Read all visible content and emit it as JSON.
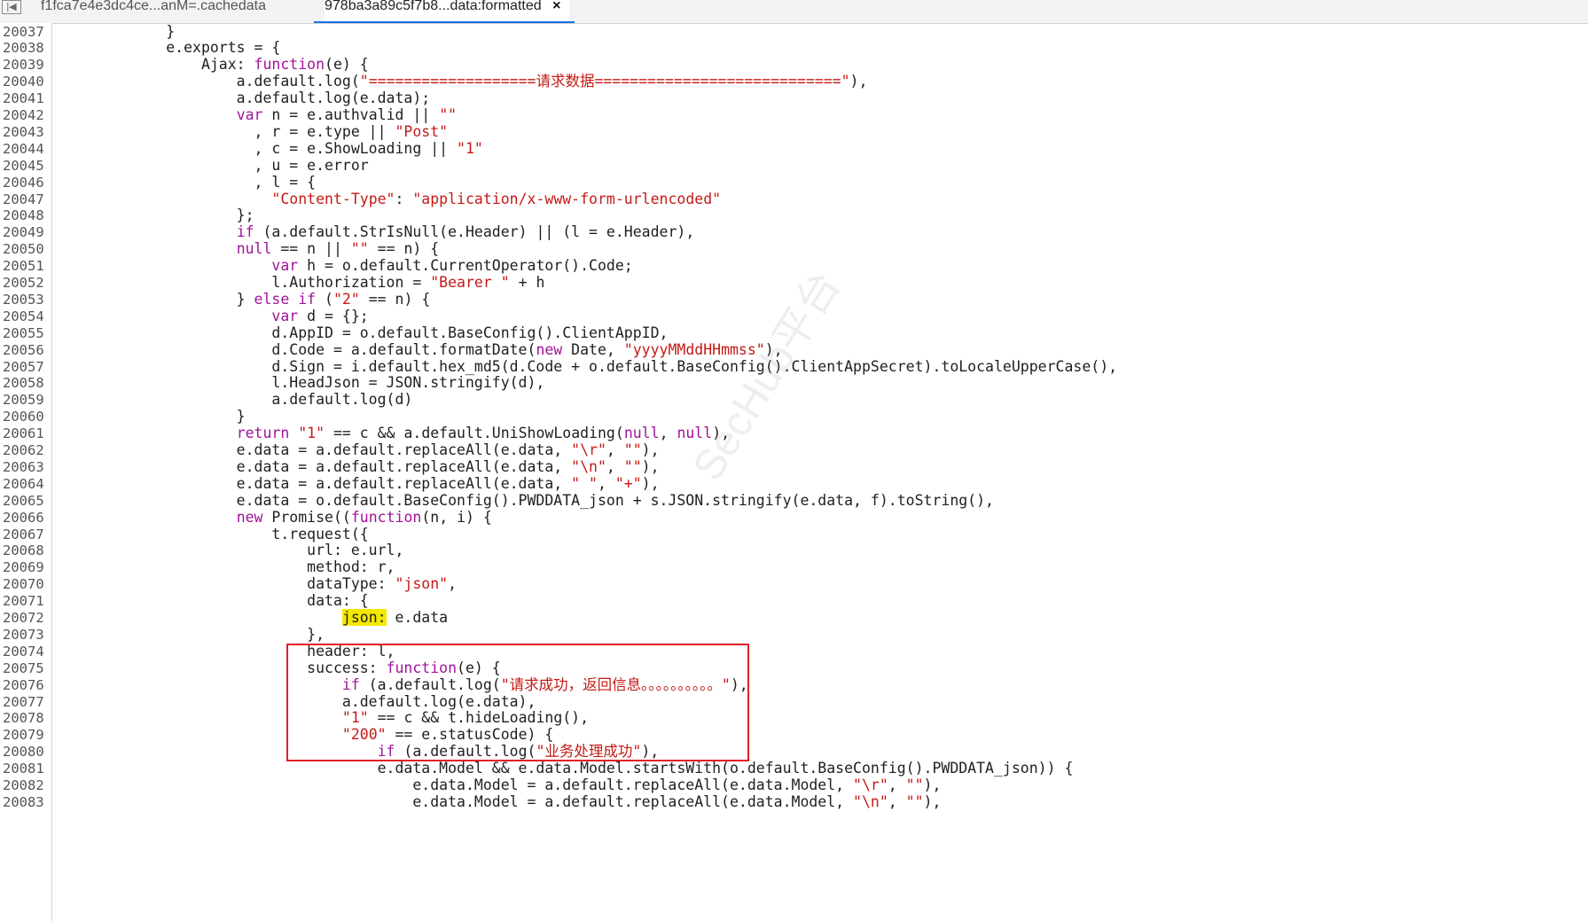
{
  "tabs": [
    {
      "label": "f1fca7e4e3dc4ce...anM=.cachedata",
      "active": false
    },
    {
      "label": "978ba3a89c5f7b8...data:formatted",
      "active": true
    }
  ],
  "close_glyph": "×",
  "watermark": "SecHub平台",
  "highlight_color": "#f4e800",
  "annotation_color": "#e51d27",
  "lines": [
    {
      "n": "20037",
      "t": [
        [
          "p",
          "            }"
        ]
      ]
    },
    {
      "n": "20038",
      "t": [
        [
          "p",
          "            e.exports = {"
        ]
      ]
    },
    {
      "n": "20039",
      "t": [
        [
          "p",
          "                Ajax: "
        ],
        [
          "k",
          "function"
        ],
        [
          "p",
          "(e) {"
        ]
      ]
    },
    {
      "n": "20040",
      "t": [
        [
          "p",
          "                    a.default.log("
        ],
        [
          "s",
          "\"===================请求数据============================\""
        ],
        [
          "p",
          "),"
        ]
      ]
    },
    {
      "n": "20041",
      "t": [
        [
          "p",
          "                    a.default.log(e.data);"
        ]
      ]
    },
    {
      "n": "20042",
      "t": [
        [
          "p",
          "                    "
        ],
        [
          "k",
          "var"
        ],
        [
          "p",
          " n = e.authvalid || "
        ],
        [
          "s",
          "\"\""
        ]
      ]
    },
    {
      "n": "20043",
      "t": [
        [
          "p",
          "                      , r = e.type || "
        ],
        [
          "s",
          "\"Post\""
        ]
      ]
    },
    {
      "n": "20044",
      "t": [
        [
          "p",
          "                      , c = e.ShowLoading || "
        ],
        [
          "s",
          "\"1\""
        ]
      ]
    },
    {
      "n": "20045",
      "t": [
        [
          "p",
          "                      , u = e.error"
        ]
      ]
    },
    {
      "n": "20046",
      "t": [
        [
          "p",
          "                      , l = {"
        ]
      ]
    },
    {
      "n": "20047",
      "t": [
        [
          "p",
          "                        "
        ],
        [
          "s",
          "\"Content-Type\""
        ],
        [
          "p",
          ": "
        ],
        [
          "s",
          "\"application/x-www-form-urlencoded\""
        ]
      ]
    },
    {
      "n": "20048",
      "t": [
        [
          "p",
          "                    };"
        ]
      ]
    },
    {
      "n": "20049",
      "t": [
        [
          "p",
          "                    "
        ],
        [
          "k",
          "if"
        ],
        [
          "p",
          " (a.default.StrIsNull(e.Header) || (l = e.Header),"
        ]
      ]
    },
    {
      "n": "20050",
      "t": [
        [
          "p",
          "                    "
        ],
        [
          "k",
          "null"
        ],
        [
          "p",
          " == n || "
        ],
        [
          "s",
          "\"\""
        ],
        [
          "p",
          " == n) {"
        ]
      ]
    },
    {
      "n": "20051",
      "t": [
        [
          "p",
          "                        "
        ],
        [
          "k",
          "var"
        ],
        [
          "p",
          " h = o.default.CurrentOperator().Code;"
        ]
      ]
    },
    {
      "n": "20052",
      "t": [
        [
          "p",
          "                        l.Authorization = "
        ],
        [
          "s",
          "\"Bearer \""
        ],
        [
          "p",
          " + h"
        ]
      ]
    },
    {
      "n": "20053",
      "t": [
        [
          "p",
          "                    } "
        ],
        [
          "k",
          "else if"
        ],
        [
          "p",
          " ("
        ],
        [
          "s",
          "\"2\""
        ],
        [
          "p",
          " == n) {"
        ]
      ]
    },
    {
      "n": "20054",
      "t": [
        [
          "p",
          "                        "
        ],
        [
          "k",
          "var"
        ],
        [
          "p",
          " d = {};"
        ]
      ]
    },
    {
      "n": "20055",
      "t": [
        [
          "p",
          "                        d.AppID = o.default.BaseConfig().ClientAppID,"
        ]
      ]
    },
    {
      "n": "20056",
      "t": [
        [
          "p",
          "                        d.Code = a.default.formatDate("
        ],
        [
          "k",
          "new"
        ],
        [
          "p",
          " Date, "
        ],
        [
          "s",
          "\"yyyyMMddHHmmss\""
        ],
        [
          "p",
          "),"
        ]
      ]
    },
    {
      "n": "20057",
      "t": [
        [
          "p",
          "                        d.Sign = i.default.hex_md5(d.Code + o.default.BaseConfig().ClientAppSecret).toLocaleUpperCase(),"
        ]
      ]
    },
    {
      "n": "20058",
      "t": [
        [
          "p",
          "                        l.HeadJson = JSON.stringify(d),"
        ]
      ]
    },
    {
      "n": "20059",
      "t": [
        [
          "p",
          "                        a.default.log(d)"
        ]
      ]
    },
    {
      "n": "20060",
      "t": [
        [
          "p",
          "                    }"
        ]
      ]
    },
    {
      "n": "20061",
      "t": [
        [
          "p",
          "                    "
        ],
        [
          "k",
          "return"
        ],
        [
          "p",
          " "
        ],
        [
          "s",
          "\"1\""
        ],
        [
          "p",
          " == c && a.default.UniShowLoading("
        ],
        [
          "k",
          "null"
        ],
        [
          "p",
          ", "
        ],
        [
          "k",
          "null"
        ],
        [
          "p",
          "),"
        ]
      ]
    },
    {
      "n": "20062",
      "t": [
        [
          "p",
          "                    e.data = a.default.replaceAll(e.data, "
        ],
        [
          "s",
          "\"\\r\""
        ],
        [
          "p",
          ", "
        ],
        [
          "s",
          "\"\""
        ],
        [
          "p",
          "),"
        ]
      ]
    },
    {
      "n": "20063",
      "t": [
        [
          "p",
          "                    e.data = a.default.replaceAll(e.data, "
        ],
        [
          "s",
          "\"\\n\""
        ],
        [
          "p",
          ", "
        ],
        [
          "s",
          "\"\""
        ],
        [
          "p",
          "),"
        ]
      ]
    },
    {
      "n": "20064",
      "t": [
        [
          "p",
          "                    e.data = a.default.replaceAll(e.data, "
        ],
        [
          "s",
          "\" \""
        ],
        [
          "p",
          ", "
        ],
        [
          "s",
          "\"+\""
        ],
        [
          "p",
          "),"
        ]
      ]
    },
    {
      "n": "20065",
      "t": [
        [
          "p",
          "                    e.data = o.default.BaseConfig().PWDDATA_json + s.JSON.stringify(e.data, f).toString(),"
        ]
      ]
    },
    {
      "n": "20066",
      "t": [
        [
          "p",
          "                    "
        ],
        [
          "k",
          "new"
        ],
        [
          "p",
          " Promise(("
        ],
        [
          "k",
          "function"
        ],
        [
          "p",
          "(n, i) {"
        ]
      ]
    },
    {
      "n": "20067",
      "t": [
        [
          "p",
          "                        t.request({"
        ]
      ]
    },
    {
      "n": "20068",
      "t": [
        [
          "p",
          "                            url: e.url,"
        ]
      ]
    },
    {
      "n": "20069",
      "t": [
        [
          "p",
          "                            method: r,"
        ]
      ]
    },
    {
      "n": "20070",
      "t": [
        [
          "p",
          "                            dataType: "
        ],
        [
          "s",
          "\"json\""
        ],
        [
          "p",
          ","
        ]
      ]
    },
    {
      "n": "20071",
      "t": [
        [
          "p",
          "                            data: {"
        ]
      ]
    },
    {
      "n": "20072",
      "t": [
        [
          "p",
          "                                "
        ],
        [
          "h",
          "json:"
        ],
        [
          "p",
          " e.data"
        ]
      ]
    },
    {
      "n": "20073",
      "t": [
        [
          "p",
          "                            },"
        ]
      ]
    },
    {
      "n": "20074",
      "t": [
        [
          "p",
          "                            header: l,"
        ]
      ]
    },
    {
      "n": "20075",
      "t": [
        [
          "p",
          "                            success: "
        ],
        [
          "k",
          "function"
        ],
        [
          "p",
          "(e) {"
        ]
      ]
    },
    {
      "n": "20076",
      "t": [
        [
          "p",
          "                                "
        ],
        [
          "k",
          "if"
        ],
        [
          "p",
          " (a.default.log("
        ],
        [
          "s",
          "\"请求成功，返回信息。。。。。。。。。。\""
        ],
        [
          "p",
          "),"
        ]
      ]
    },
    {
      "n": "20077",
      "t": [
        [
          "p",
          "                                a.default.log(e.data),"
        ]
      ]
    },
    {
      "n": "20078",
      "t": [
        [
          "p",
          "                                "
        ],
        [
          "s",
          "\"1\""
        ],
        [
          "p",
          " == c && t.hideLoading(),"
        ]
      ]
    },
    {
      "n": "20079",
      "t": [
        [
          "p",
          "                                "
        ],
        [
          "s",
          "\"200\""
        ],
        [
          "p",
          " == e.statusCode) {"
        ]
      ]
    },
    {
      "n": "20080",
      "t": [
        [
          "p",
          "                                    "
        ],
        [
          "k",
          "if"
        ],
        [
          "p",
          " (a.default.log("
        ],
        [
          "s",
          "\"业务处理成功\""
        ],
        [
          "p",
          "),"
        ]
      ]
    },
    {
      "n": "20081",
      "t": [
        [
          "p",
          "                                    e.data.Model && e.data.Model.startsWith(o.default.BaseConfig().PWDDATA_json)) {"
        ]
      ]
    },
    {
      "n": "20082",
      "t": [
        [
          "p",
          "                                        e.data.Model = a.default.replaceAll(e.data.Model, "
        ],
        [
          "s",
          "\"\\r\""
        ],
        [
          "p",
          ", "
        ],
        [
          "s",
          "\"\""
        ],
        [
          "p",
          "),"
        ]
      ]
    },
    {
      "n": "20083",
      "t": [
        [
          "p",
          "                                        e.data.Model = a.default.replaceAll(e.data.Model, "
        ],
        [
          "s",
          "\"\\n\""
        ],
        [
          "p",
          ", "
        ],
        [
          "s",
          "\"\""
        ],
        [
          "p",
          "),"
        ]
      ]
    }
  ]
}
